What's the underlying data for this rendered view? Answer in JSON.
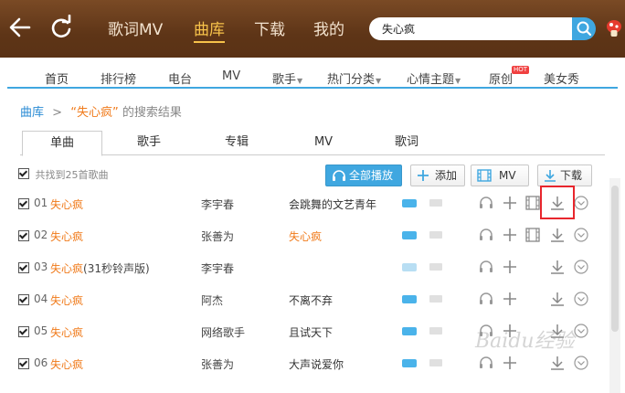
{
  "topbar": {
    "nav": [
      "歌词MV",
      "曲库",
      "下载",
      "我的"
    ],
    "active_index": 1,
    "search_value": "失心疯"
  },
  "subnav": {
    "items": [
      "首页",
      "排行榜",
      "电台",
      "MV",
      "歌手",
      "热门分类",
      "心情主题",
      "原创",
      "美女秀"
    ],
    "hot_badge": "HOT"
  },
  "breadcrumb": {
    "root": "曲库",
    "sep": ">",
    "keyword": "“失心疯”",
    "suffix": "的搜索结果"
  },
  "tabs": [
    "单曲",
    "歌手",
    "专辑",
    "MV",
    "歌词"
  ],
  "result": {
    "count_text": "共找到25首歌曲"
  },
  "actions": {
    "play_all": "全部播放",
    "add": "添加",
    "mv": "MV",
    "download": "下载"
  },
  "songs": [
    {
      "num": "01",
      "title": "失心疯",
      "suffix": "",
      "singer": "李宇春",
      "album": "会跳舞的文艺青年"
    },
    {
      "num": "02",
      "title": "失心疯",
      "suffix": "",
      "singer": "张善为",
      "album": "失心疯"
    },
    {
      "num": "03",
      "title": "失心疯",
      "suffix": "(31秒铃声版)",
      "singer": "李宇春",
      "album": ""
    },
    {
      "num": "04",
      "title": "失心疯",
      "suffix": "",
      "singer": "阿杰",
      "album": "不离不弃"
    },
    {
      "num": "05",
      "title": "失心疯",
      "suffix": "",
      "singer": "网络歌手",
      "album": "且试天下"
    },
    {
      "num": "06",
      "title": "失心疯",
      "suffix": "",
      "singer": "张善为",
      "album": "大声说爱你"
    }
  ],
  "colors": {
    "accent_blue": "#3fa7e0",
    "song_orange": "#f07a1a",
    "topbar_brown": "#5e3517",
    "highlight_red": "#e8262d"
  },
  "watermark": "Baidu经验"
}
